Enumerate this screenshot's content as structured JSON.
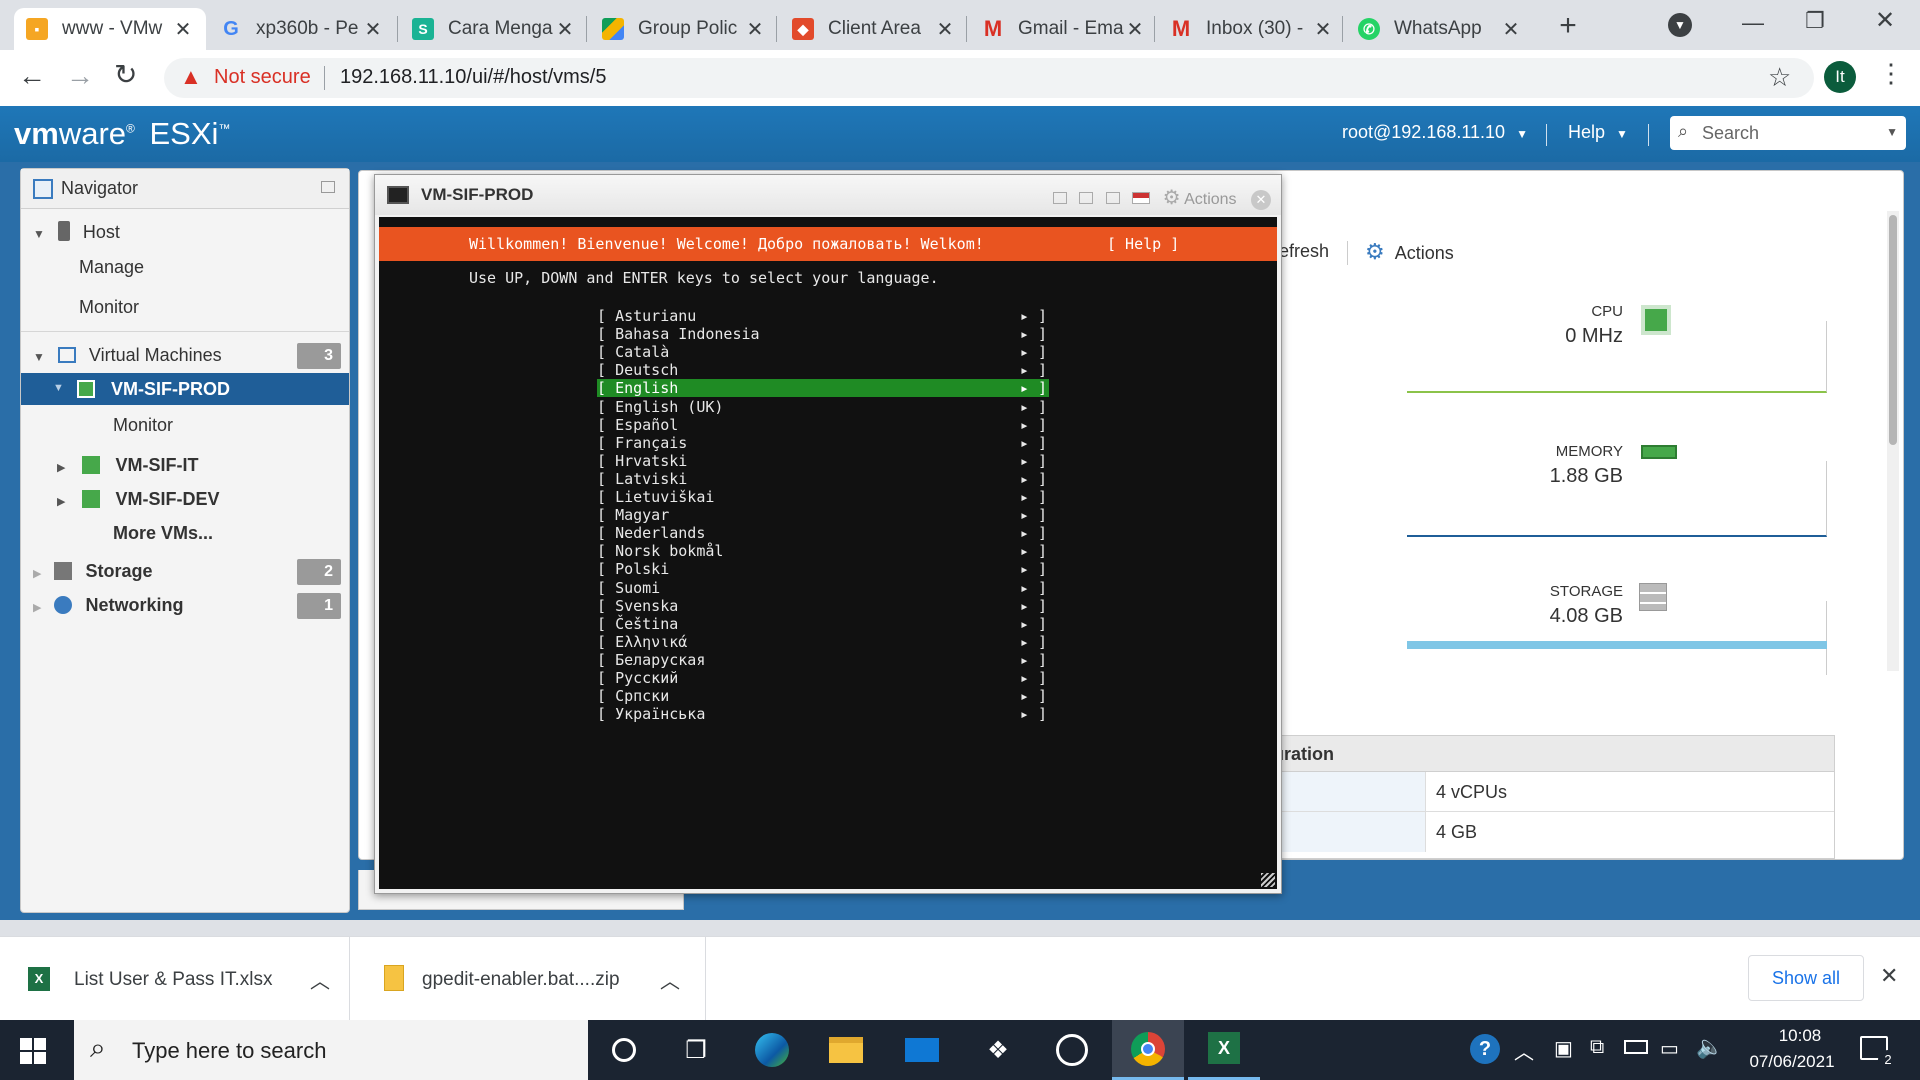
{
  "browser": {
    "tabs": [
      {
        "label": "www - VMw",
        "icon": "vmware-favicon",
        "active": true
      },
      {
        "label": "xp360b - Pe",
        "icon": "google-favicon"
      },
      {
        "label": "Cara Menga",
        "icon": "blog-favicon"
      },
      {
        "label": "Group Polic",
        "icon": "drive-favicon"
      },
      {
        "label": "Client Area",
        "icon": "client-favicon"
      },
      {
        "label": "Gmail - Ema",
        "icon": "gmail-favicon"
      },
      {
        "label": "Inbox (30) -",
        "icon": "gmail-favicon"
      },
      {
        "label": "WhatsApp",
        "icon": "whatsapp-favicon"
      }
    ],
    "new_tab": "+",
    "security_label": "Not secure",
    "url": "192.168.11.10/ui/#/host/vms/5",
    "profile_initials": "It"
  },
  "esxi": {
    "logo_vm": "vm",
    "logo_ware": "ware",
    "logo_esxi": "ESXi",
    "user": "root@192.168.11.10",
    "help": "Help",
    "search_placeholder": "Search"
  },
  "navigator": {
    "title": "Navigator",
    "host": "Host",
    "manage": "Manage",
    "monitor": "Monitor",
    "virtual_machines": "Virtual Machines",
    "vm_count": "3",
    "selected_vm": "VM-SIF-PROD",
    "vm_monitor": "Monitor",
    "vm_it": "VM-SIF-IT",
    "vm_dev": "VM-SIF-DEV",
    "more_vms": "More VMs...",
    "storage": "Storage",
    "storage_count": "2",
    "networking": "Networking",
    "networking_count": "1"
  },
  "vm_panel": {
    "refresh_partial": "efresh",
    "actions": "Actions",
    "cpu_label": "CPU",
    "cpu_value": "0 MHz",
    "memory_label": "MEMORY",
    "memory_value": "1.88 GB",
    "storage_label": "STORAGE",
    "storage_value": "4.08 GB",
    "config_header": "nfiguration",
    "config_rows": [
      "4 vCPUs",
      "4 GB"
    ]
  },
  "console": {
    "title": "VM-SIF-PROD",
    "actions": "Actions",
    "banner": "Willkommen! Bienvenue! Welcome! Добро пожаловать! Welkom!",
    "help": "[ Help ]",
    "instruction": "Use UP, DOWN and ENTER keys to select your language.",
    "languages": [
      "Asturianu",
      "Bahasa Indonesia",
      "Català",
      "Deutsch",
      "English",
      "English (UK)",
      "Español",
      "Français",
      "Hrvatski",
      "Latviski",
      "Lietuviškai",
      "Magyar",
      "Nederlands",
      "Norsk bokmål",
      "Polski",
      "Suomi",
      "Svenska",
      "Čeština",
      "Ελληνικά",
      "Беларуская",
      "Русский",
      "Српски",
      "Українська"
    ],
    "selected_language": "English"
  },
  "downloads": {
    "items": [
      "List User & Pass IT.xlsx",
      "gpedit-enabler.bat....zip"
    ],
    "show_all": "Show all"
  },
  "taskbar": {
    "search_placeholder": "Type here to search",
    "time": "10:08",
    "date": "07/06/2021",
    "notification_count": "2"
  }
}
